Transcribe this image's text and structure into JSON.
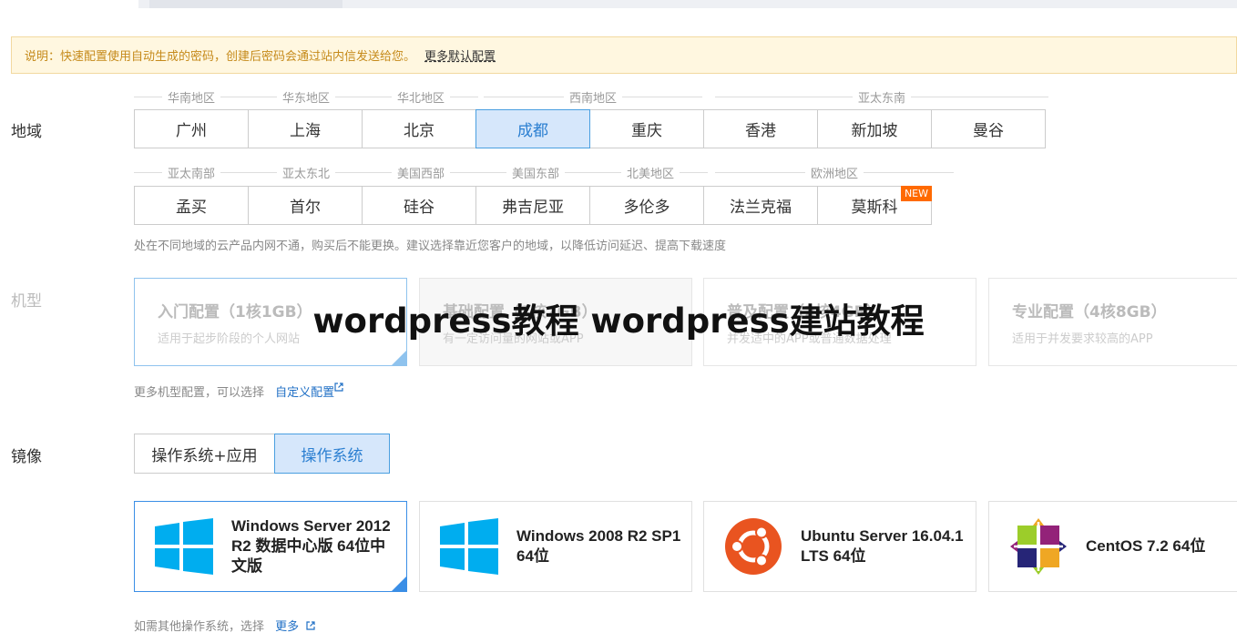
{
  "notice": {
    "text": "说明：快速配置使用自动生成的密码，创建后密码会通过站内信发送给您。",
    "link": "更多默认配置"
  },
  "labels": {
    "region": "地域",
    "instance": "机型",
    "image": "镜像"
  },
  "region_groups_row1": [
    "华南地区",
    "华东地区",
    "华北地区",
    "西南地区",
    "亚太东南"
  ],
  "cities_row1": [
    "广州",
    "上海",
    "北京",
    "成都",
    "重庆",
    "香港",
    "新加坡",
    "曼谷"
  ],
  "region_groups_row2": [
    "亚太南部",
    "亚太东北",
    "美国西部",
    "美国东部",
    "北美地区",
    "欧洲地区"
  ],
  "cities_row2": [
    "孟买",
    "首尔",
    "硅谷",
    "弗吉尼亚",
    "多伦多",
    "法兰克福",
    "莫斯科"
  ],
  "new_badge": "NEW",
  "region_hint": "处在不同地域的云产品内网不通，购买后不能更换。建议选择靠近您客户的地域，以降低访问延迟、提高下载速度",
  "plans": [
    {
      "title": "入门配置（1核1GB）",
      "sub": "适用于起步阶段的个人网站"
    },
    {
      "title": "基础配置（1核2GB）",
      "sub": "有一定访问量的网站或APP"
    },
    {
      "title": "普及配置（2核4GB）",
      "sub": "并发适中的APP或普通数据处理"
    },
    {
      "title": "专业配置（4核8GB）",
      "sub": "适用于并发要求较高的APP"
    }
  ],
  "plan_hint": "更多机型配置，可以选择",
  "plan_link": "自定义配置",
  "watermark": "wordpress教程 wordpress建站教程",
  "image_tabs": [
    "操作系统+应用",
    "操作系统"
  ],
  "os_images": [
    {
      "name": "Windows Server 2012 R2 数据中心版 64位中文版",
      "icon": "windows-logo"
    },
    {
      "name": "Windows 2008 R2 SP1 64位",
      "icon": "windows-logo"
    },
    {
      "name": "Ubuntu Server 16.04.1 LTS 64位",
      "icon": "ubuntu-logo"
    },
    {
      "name": "CentOS 7.2 64位",
      "icon": "centos-logo"
    }
  ],
  "os_hint": "如需其他操作系统，选择",
  "os_link": "更多",
  "colors": {
    "accent": "#2b7fd1",
    "selected_bg": "#d6e7fb",
    "notice_bg": "#fff7e0",
    "new_badge": "#ff6a00",
    "windows": "#00adef",
    "ubuntu": "#e95420"
  }
}
